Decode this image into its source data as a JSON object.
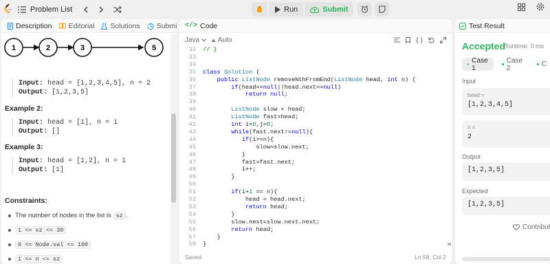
{
  "topbar": {
    "problem_list_label": "Problem List",
    "run_label": "Run",
    "submit_label": "Submit"
  },
  "colors": {
    "accent_green": "#2db55d",
    "logo_orange": "#ffa116"
  },
  "description_panel": {
    "tabs": [
      {
        "label": "Description",
        "icon": "document-icon"
      },
      {
        "label": "Editorial",
        "icon": "book-icon"
      },
      {
        "label": "Solutions",
        "icon": "flask-icon"
      },
      {
        "label": "Submissions",
        "icon": "history-icon"
      }
    ],
    "diagram_nodes": [
      "1",
      "2",
      "3",
      "5"
    ],
    "example1": {
      "input_label": "Input:",
      "input": "head = [1,2,3,4,5], n = 2",
      "output_label": "Output:",
      "output": "[1,2,3,5]"
    },
    "example2": {
      "title": "Example 2:",
      "input_label": "Input:",
      "input": "head = [1], n = 1",
      "output_label": "Output:",
      "output": "[]"
    },
    "example3": {
      "title": "Example 3:",
      "input_label": "Input:",
      "input": "head = [1,2], n = 1",
      "output_label": "Output:",
      "output": "[1]"
    },
    "constraints_title": "Constraints:",
    "constraint1_text": "The number of nodes in the list is",
    "constraint1_code": "sz",
    "constraint1_end": ".",
    "constraint2": "1 <= sz <= 30",
    "constraint3": "0 <= Node.val <= 100",
    "constraint4": "1 <= n <= sz"
  },
  "code_panel": {
    "title": "Code",
    "language": "Java",
    "autosave": "Auto",
    "lines": [
      {
        "n": "32",
        "t": "// }"
      },
      {
        "n": "33",
        "t": ""
      },
      {
        "n": "34",
        "t": ""
      },
      {
        "n": "35",
        "t": "class Solution {"
      },
      {
        "n": "36",
        "t": "    public ListNode removeNthFromEnd(ListNode head, int n) {"
      },
      {
        "n": "37",
        "t": "        if(head==null||head.next==null)"
      },
      {
        "n": "38",
        "t": "            return null;"
      },
      {
        "n": "39",
        "t": ""
      },
      {
        "n": "40",
        "t": "        ListNode slow = head;"
      },
      {
        "n": "41",
        "t": "        ListNode fast=head;"
      },
      {
        "n": "42",
        "t": "        int i=0,j=0;"
      },
      {
        "n": "43",
        "t": "        while(fast.next!=null){"
      },
      {
        "n": "44",
        "t": "           if(i>=n){"
      },
      {
        "n": "45",
        "t": "               slow=slow.next;"
      },
      {
        "n": "46",
        "t": "           }"
      },
      {
        "n": "47",
        "t": "           fast=fast.next;"
      },
      {
        "n": "48",
        "t": "           i++;"
      },
      {
        "n": "49",
        "t": "        }"
      },
      {
        "n": "50",
        "t": ""
      },
      {
        "n": "51",
        "t": "        if(i+1 == n){"
      },
      {
        "n": "52",
        "t": "            head = head.next;"
      },
      {
        "n": "53",
        "t": "            return head;"
      },
      {
        "n": "54",
        "t": "        }"
      },
      {
        "n": "55",
        "t": "        slow.next=slow.next.next;"
      },
      {
        "n": "56",
        "t": "        return head;"
      },
      {
        "n": "57",
        "t": "    }"
      },
      {
        "n": "58",
        "t": "}"
      }
    ],
    "status_saved": "Saved",
    "cursor_pos": "Ln 58, Col 2"
  },
  "test_panel": {
    "title": "Test Result",
    "result": "Accepted",
    "runtime": "Runtime: 0 ms",
    "cases": [
      "Case 1",
      "Case 2",
      "C"
    ],
    "input_label": "Input",
    "head_label": "head =",
    "head_value": "[1,2,3,4,5]",
    "n_label": "n =",
    "n_value": "2",
    "output_label": "Output",
    "output_value": "[1,2,3,5]",
    "expected_label": "Expected",
    "expected_value": "[1,2,3,5]",
    "contribute_label": "Contribute"
  }
}
